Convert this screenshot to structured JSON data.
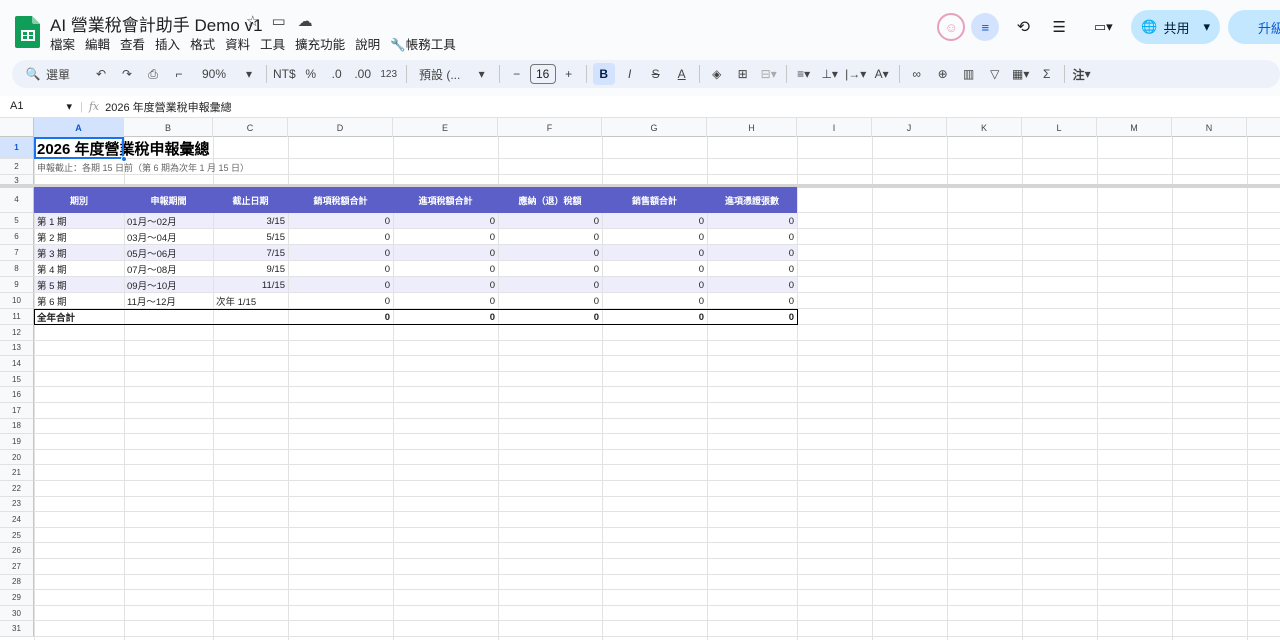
{
  "doc": {
    "title": "AI 營業稅會計助手 Demo v1",
    "menu": [
      "檔案",
      "編輯",
      "查看",
      "插入",
      "格式",
      "資料",
      "工具",
      "擴充功能",
      "說明",
      "帳務工具"
    ],
    "share_label": "共用",
    "upgrade_label": "升級"
  },
  "toolbar": {
    "search_label": "選單",
    "zoom": "90%",
    "currency": "NT$",
    "percent": "%",
    "dec_decrease": ".0",
    "dec_increase": ".00",
    "format_123": "123",
    "font": "預設 (...",
    "font_size": "16",
    "bold": "B",
    "italic": "I",
    "strike": "S",
    "textcolor": "A",
    "sigma": "Σ",
    "note": "注"
  },
  "formula_bar": {
    "cell_ref": "A1",
    "formula": "2026 年度營業稅申報彙總"
  },
  "columns": [
    "A",
    "B",
    "C",
    "D",
    "E",
    "F",
    "G",
    "H",
    "I",
    "J",
    "K",
    "L",
    "M",
    "N"
  ],
  "rows": [
    "1",
    "2",
    "3",
    "4",
    "5",
    "6",
    "7",
    "8",
    "9",
    "10",
    "11",
    "12",
    "13",
    "14",
    "15",
    "16",
    "17",
    "18",
    "19",
    "20",
    "21",
    "22",
    "23",
    "24",
    "25",
    "26",
    "27",
    "28",
    "29",
    "30",
    "31"
  ],
  "sheet": {
    "title": "2026 年度營業稅申報彙總",
    "subtitle": "申報截止：各期 15 日前（第 6 期為次年 1 月 15 日）",
    "headers": [
      "期別",
      "申報期間",
      "截止日期",
      "銷項稅額合計",
      "進項稅額合計",
      "應納（退）稅額",
      "銷售額合計",
      "進項憑證張數"
    ],
    "data": [
      [
        "第 1 期",
        "01月～02月",
        "3/15",
        "0",
        "0",
        "0",
        "0",
        "0"
      ],
      [
        "第 2 期",
        "03月～04月",
        "5/15",
        "0",
        "0",
        "0",
        "0",
        "0"
      ],
      [
        "第 3 期",
        "05月～06月",
        "7/15",
        "0",
        "0",
        "0",
        "0",
        "0"
      ],
      [
        "第 4 期",
        "07月～08月",
        "9/15",
        "0",
        "0",
        "0",
        "0",
        "0"
      ],
      [
        "第 5 期",
        "09月～10月",
        "11/15",
        "0",
        "0",
        "0",
        "0",
        "0"
      ],
      [
        "第 6 期",
        "11月～12月",
        "次年 1/15",
        "0",
        "0",
        "0",
        "0",
        "0"
      ]
    ],
    "total": [
      "全年合計",
      "",
      "",
      "0",
      "0",
      "0",
      "0",
      "0"
    ]
  },
  "colors": {
    "header_bg": "#5b5fc7",
    "band": "#ededfb",
    "accent": "#0b57d0"
  }
}
